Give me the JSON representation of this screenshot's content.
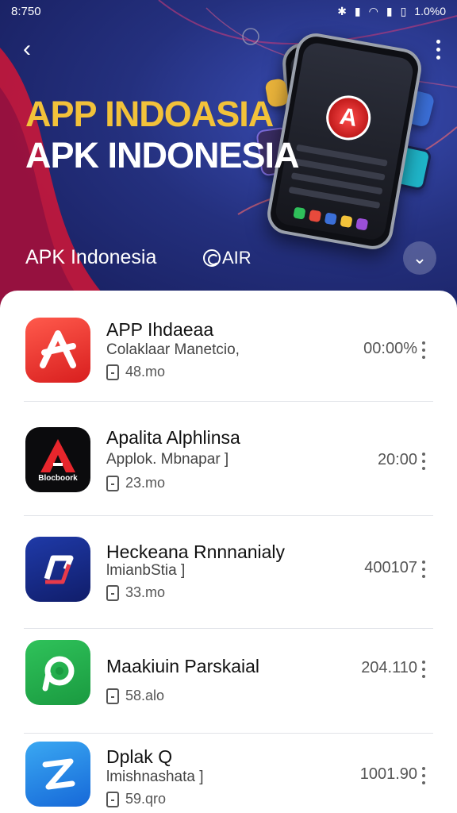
{
  "statusbar": {
    "time": "8:750",
    "battery": "1.0%0"
  },
  "hero": {
    "title_line1": "APP INDOASIA",
    "title_line2": "APK INDONESIA",
    "subtitle": "APK Indonesia",
    "brand": "AIR",
    "phone_logo": "A",
    "colors": {
      "title_accent": "#f2c23a",
      "swoosh": "#d0173a"
    }
  },
  "apps": [
    {
      "name": "APP Ihdaeaa",
      "developer": "Colaklaar Manetcio,",
      "size": "48.mo",
      "value": "00:00%",
      "icon": "red-star-app-icon",
      "icon_text": ""
    },
    {
      "name": "Apalita Alphlinsa",
      "developer": "Applok. Mbnapar ]",
      "size": "23.mo",
      "value": "20:00",
      "icon": "black-a-app-icon",
      "icon_text": "Blocboork"
    },
    {
      "name": "Heckeana Rnnnanialy",
      "developer": "lmianbStia ]",
      "size": "33.mo",
      "value": "400107",
      "icon": "blue-swoosh-app-icon",
      "icon_text": ""
    },
    {
      "name": "Maakiuin Parskaial",
      "developer": "",
      "size": "58.alo",
      "value": "204.110",
      "icon": "green-p-app-icon",
      "icon_text": ""
    },
    {
      "name": "Dplak Q",
      "developer": "lmishnashata ]",
      "size": "59.qro",
      "value": "1001.90",
      "icon": "blue-z-app-icon",
      "icon_text": ""
    }
  ]
}
